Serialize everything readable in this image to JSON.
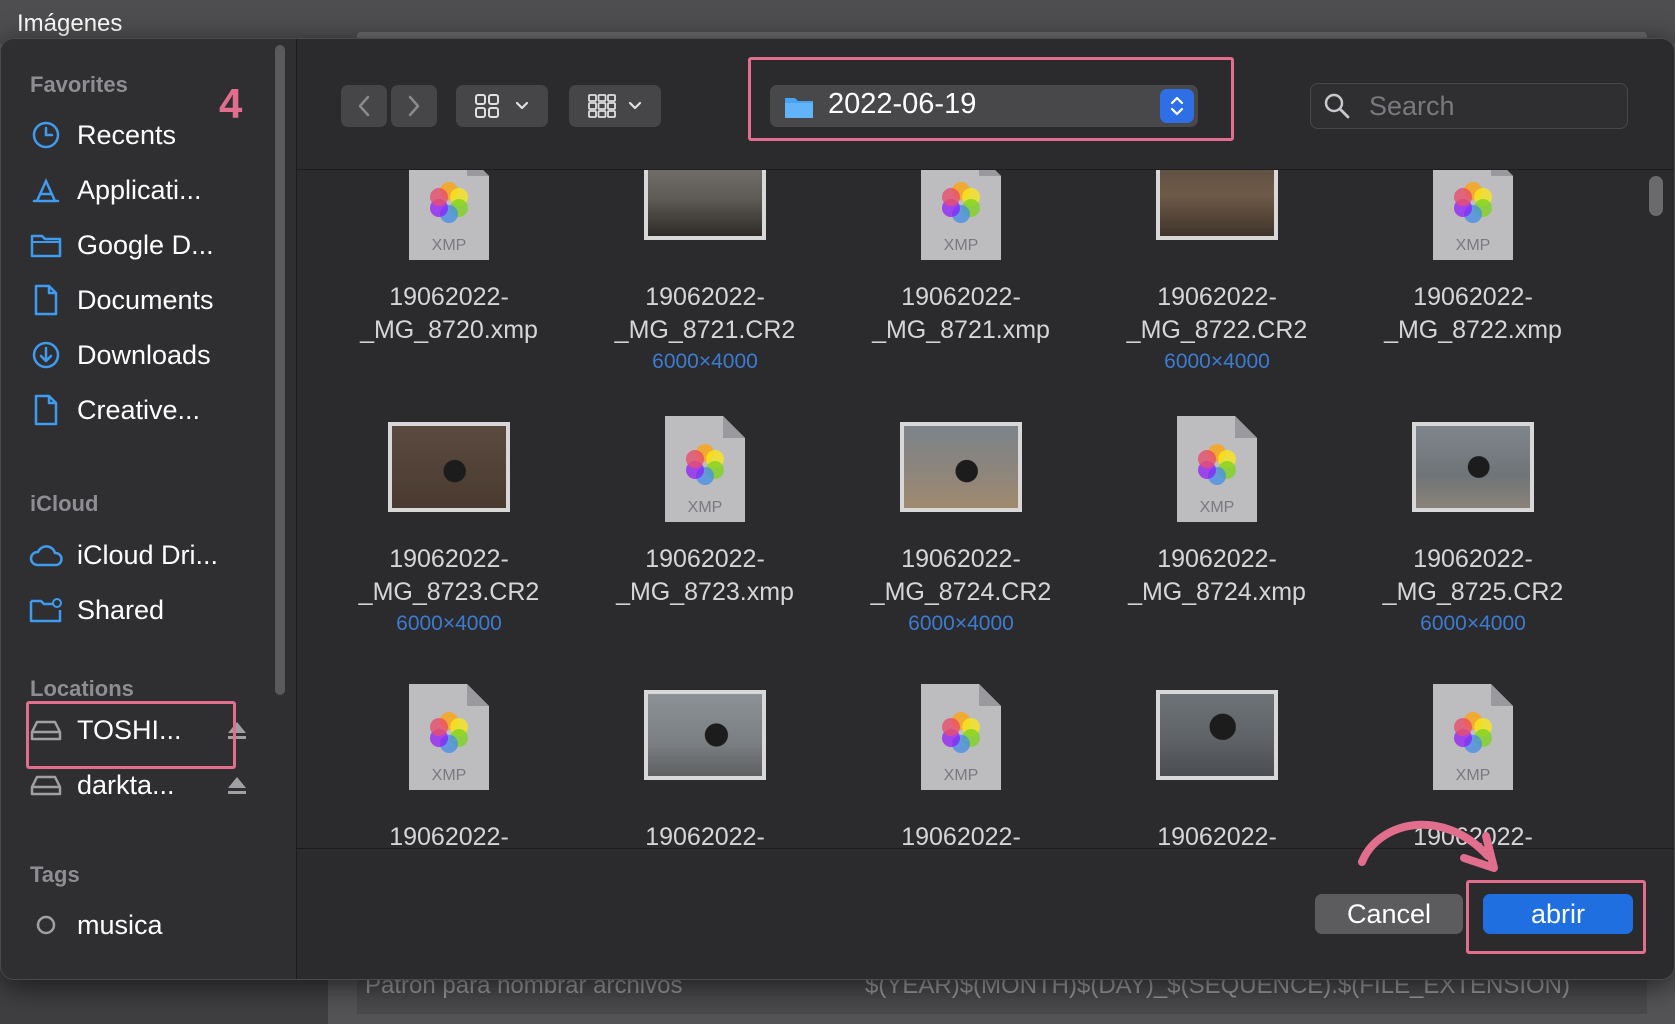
{
  "background": {
    "window_title": "Imágenes",
    "pattern_label": "Patron para nombrar archivos",
    "pattern_value": "$(YEAR)$(MONTH)$(DAY)_$(SEQUENCE).$(FILE_EXTENSION)"
  },
  "annotations": {
    "step_number": "4",
    "highlight_color": "#e26e8e"
  },
  "sidebar": {
    "favorites_title": "Favorites",
    "favorites": [
      {
        "label": "Recents",
        "icon": "clock-icon"
      },
      {
        "label": "Applicati...",
        "icon": "applications-icon"
      },
      {
        "label": "Google D...",
        "icon": "folder-icon"
      },
      {
        "label": "Documents",
        "icon": "document-icon"
      },
      {
        "label": "Downloads",
        "icon": "download-icon"
      },
      {
        "label": "Creative...",
        "icon": "document-icon"
      }
    ],
    "icloud_title": "iCloud",
    "icloud": [
      {
        "label": "iCloud Dri...",
        "icon": "cloud-icon"
      },
      {
        "label": "Shared",
        "icon": "shared-folder-icon"
      }
    ],
    "locations_title": "Locations",
    "locations": [
      {
        "label": "TOSHI...",
        "icon": "drive-icon"
      },
      {
        "label": "darkta...",
        "icon": "drive-icon"
      }
    ],
    "tags_title": "Tags",
    "tags": [
      {
        "label": "musica",
        "icon": "tag-circle-icon"
      }
    ]
  },
  "toolbar": {
    "current_folder": "2022-06-19",
    "search_placeholder": "Search"
  },
  "files": {
    "items": [
      {
        "name1": "19062022-",
        "name2": "_MG_8720.xmp",
        "dims": "",
        "type": "xmp"
      },
      {
        "name1": "19062022-",
        "name2": "_MG_8721.CR2",
        "dims": "6000×4000",
        "type": "photo"
      },
      {
        "name1": "19062022-",
        "name2": "_MG_8721.xmp",
        "dims": "",
        "type": "xmp"
      },
      {
        "name1": "19062022-",
        "name2": "_MG_8722.CR2",
        "dims": "6000×4000",
        "type": "photo"
      },
      {
        "name1": "19062022-",
        "name2": "_MG_8722.xmp",
        "dims": "",
        "type": "xmp"
      },
      {
        "name1": "19062022-",
        "name2": "_MG_8723.CR2",
        "dims": "6000×4000",
        "type": "photo"
      },
      {
        "name1": "19062022-",
        "name2": "_MG_8723.xmp",
        "dims": "",
        "type": "xmp"
      },
      {
        "name1": "19062022-",
        "name2": "_MG_8724.CR2",
        "dims": "6000×4000",
        "type": "photo"
      },
      {
        "name1": "19062022-",
        "name2": "_MG_8724.xmp",
        "dims": "",
        "type": "xmp"
      },
      {
        "name1": "19062022-",
        "name2": "_MG_8725.CR2",
        "dims": "6000×4000",
        "type": "photo"
      },
      {
        "name1": "19062022-",
        "name2": "",
        "dims": "",
        "type": "xmp"
      },
      {
        "name1": "19062022-",
        "name2": "",
        "dims": "",
        "type": "photo"
      },
      {
        "name1": "19062022-",
        "name2": "",
        "dims": "",
        "type": "xmp"
      },
      {
        "name1": "19062022-",
        "name2": "",
        "dims": "",
        "type": "photo"
      },
      {
        "name1": "19062022-",
        "name2": "",
        "dims": "",
        "type": "xmp"
      }
    ],
    "xmp_label": "XMP"
  },
  "buttons": {
    "cancel": "Cancel",
    "open": "abrir"
  },
  "colors": {
    "accent": "#1f6fe0",
    "folder_blue": "#3f9bf0",
    "dimension_text": "#3d7bd1"
  }
}
